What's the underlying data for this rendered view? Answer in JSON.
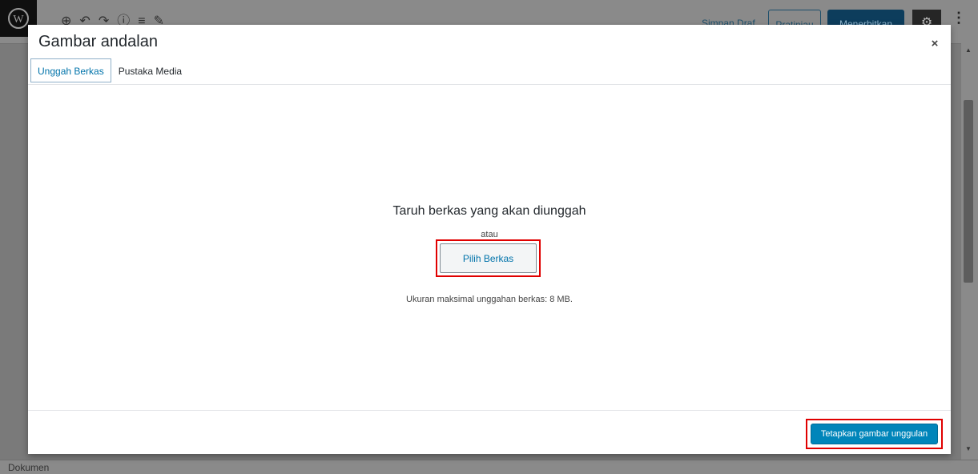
{
  "editor": {
    "save_draft": "Simpan Draf",
    "preview": "Pratinjau",
    "publish": "Menerbitkan",
    "status_bar": "Dokumen"
  },
  "modal": {
    "title": "Gambar andalan",
    "close_symbol": "×",
    "tabs": [
      {
        "label": "Unggah Berkas",
        "active": true
      },
      {
        "label": "Pustaka Media",
        "active": false
      }
    ],
    "upload": {
      "drop_text": "Taruh berkas yang akan diunggah",
      "or_text": "atau",
      "select_button": "Pilih Berkas",
      "max_size": "Ukuran maksimal unggahan berkas: 8 MB."
    },
    "footer": {
      "set_button": "Tetapkan gambar unggulan"
    }
  },
  "colors": {
    "accent": "#0085ba",
    "highlight_box": "#e00000",
    "overlay": "#7a7a7a"
  },
  "icons": [
    "wordpress-logo-icon",
    "add-block-icon",
    "undo-icon",
    "redo-icon",
    "info-icon",
    "outline-icon",
    "edit-icon",
    "gear-icon",
    "more-icon",
    "close-icon"
  ]
}
